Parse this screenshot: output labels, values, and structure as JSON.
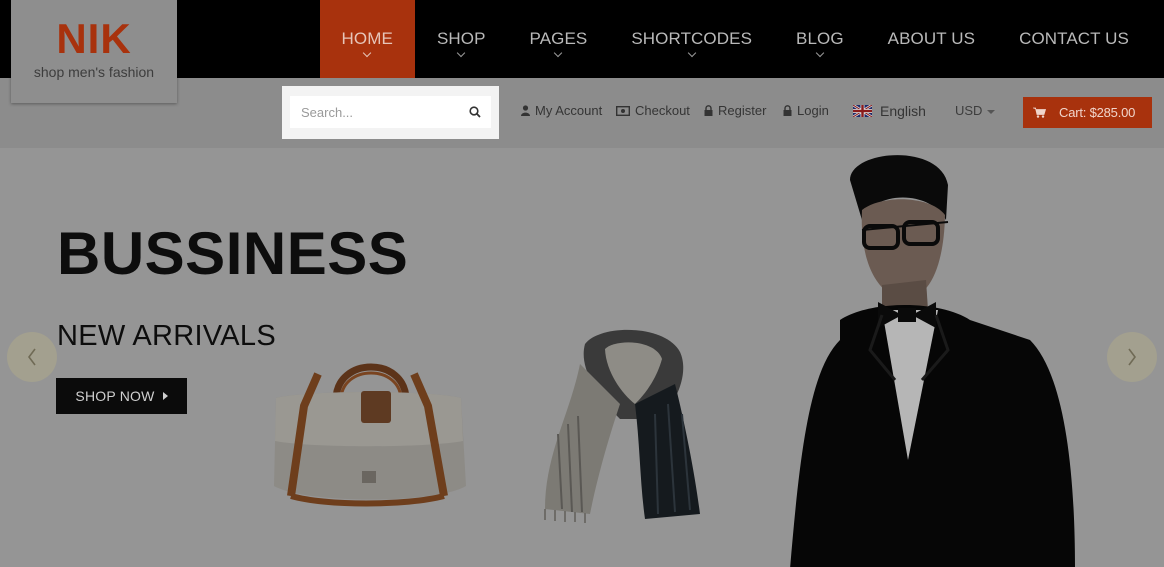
{
  "logo": {
    "brand": "NIK",
    "tagline": "shop men's fashion"
  },
  "nav": {
    "items": [
      {
        "label": "HOME",
        "active": true
      },
      {
        "label": "SHOP",
        "active": false
      },
      {
        "label": "PAGES",
        "active": false
      },
      {
        "label": "SHORTCODES",
        "active": false
      },
      {
        "label": "BLOG",
        "active": false
      },
      {
        "label": "ABOUT US",
        "active": false
      },
      {
        "label": "CONTACT US",
        "active": false
      }
    ]
  },
  "search": {
    "placeholder": "Search...",
    "value": ""
  },
  "util": {
    "account": "My Account",
    "checkout": "Checkout",
    "register": "Register",
    "login": "Login",
    "language": "English",
    "currency": "USD"
  },
  "cart": {
    "label": "Cart: $285.00"
  },
  "hero": {
    "title": "BUSSINESS",
    "subtitle": "NEW ARRIVALS",
    "button": "SHOP NOW"
  },
  "colors": {
    "accent": "#a8320d",
    "overlay_bg": "#8f8f8f",
    "topbar": "#000000"
  },
  "icons": [
    "user-icon",
    "checkout-icon",
    "lock-icon",
    "uk-flag-icon",
    "cart-icon",
    "search-icon",
    "chevron-left-icon",
    "chevron-right-icon"
  ]
}
